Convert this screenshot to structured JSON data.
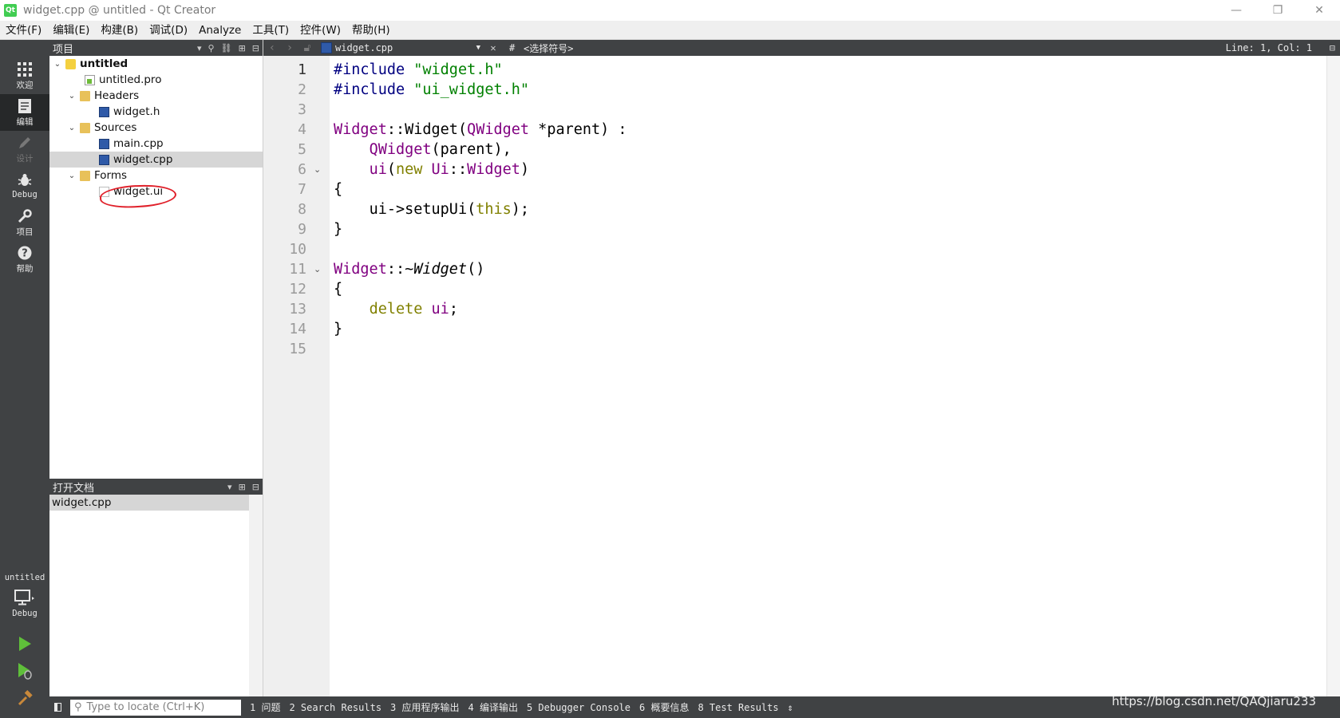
{
  "window": {
    "app_icon": "Qt",
    "title": "widget.cpp @ untitled - Qt Creator",
    "controls": [
      "—",
      "❐",
      "✕"
    ]
  },
  "menu": [
    "文件(F)",
    "编辑(E)",
    "构建(B)",
    "调试(D)",
    "Analyze",
    "工具(T)",
    "控件(W)",
    "帮助(H)"
  ],
  "modes": [
    {
      "label": "欢迎",
      "icon": "grid-icon"
    },
    {
      "label": "编辑",
      "icon": "edit-doc-icon",
      "active": true
    },
    {
      "label": "设计",
      "icon": "pencil-icon",
      "disabled": true
    },
    {
      "label": "Debug",
      "icon": "bug-icon"
    },
    {
      "label": "项目",
      "icon": "wrench-icon"
    },
    {
      "label": "帮助",
      "icon": "help-icon"
    }
  ],
  "kit": {
    "project": "untitled",
    "build": "Debug"
  },
  "project_panel": {
    "title": "项目",
    "tree": {
      "root": "untitled",
      "pro_file": "untitled.pro",
      "headers": "Headers",
      "header_file": "widget.h",
      "sources": "Sources",
      "source_main": "main.cpp",
      "source_widget": "widget.cpp",
      "forms": "Forms",
      "form_file": "widget.ui"
    }
  },
  "open_docs": {
    "title": "打开文档",
    "items": [
      "widget.cpp"
    ]
  },
  "editor": {
    "file": "widget.cpp",
    "symbol": "<选择符号>",
    "hash": "#",
    "position": "Line: 1, Col: 1",
    "line_numbers": [
      "1",
      "2",
      "3",
      "4",
      "5",
      "6",
      "7",
      "8",
      "9",
      "10",
      "11",
      "12",
      "13",
      "14",
      "15"
    ],
    "code": {
      "l1_dir": "#include",
      "l1_str": "\"widget.h\"",
      "l2_dir": "#include",
      "l2_str": "\"ui_widget.h\"",
      "l4_a": "Widget",
      "l4_b": "::",
      "l4_c": "Widget",
      "l4_d": "(",
      "l4_e": "QWidget",
      "l4_f": " *parent) :",
      "l5_a": "QWidget",
      "l5_b": "(parent),",
      "l6_a": "ui",
      "l6_b": "(",
      "l6_c": "new",
      "l6_d": " ",
      "l6_e": "Ui",
      "l6_f": "::",
      "l6_g": "Widget",
      "l6_h": ")",
      "l7": "{",
      "l8_a": "ui->setupUi(",
      "l8_b": "this",
      "l8_c": ");",
      "l9": "}",
      "l11_a": "Widget",
      "l11_b": "::",
      "l11_c": "~Widget",
      "l11_d": "()",
      "l12": "{",
      "l13_a": "delete",
      "l13_b": " ",
      "l13_c": "ui",
      "l13_d": ";",
      "l14": "}"
    }
  },
  "statusbar": {
    "locator_placeholder": "Type to locate (Ctrl+K)",
    "panes": [
      "1 问题",
      "2 Search Results",
      "3 应用程序输出",
      "4 编译输出",
      "5 Debugger Console",
      "6 概要信息",
      "8 Test Results"
    ],
    "more": "⇕"
  },
  "watermark": "https://blog.csdn.net/QAQjiaru233",
  "colors": {
    "sidebar": "#404244",
    "preprocessor": "#000080",
    "string": "#008000",
    "type": "#800080",
    "keyword": "#808000",
    "annotation": "#e0202a"
  }
}
